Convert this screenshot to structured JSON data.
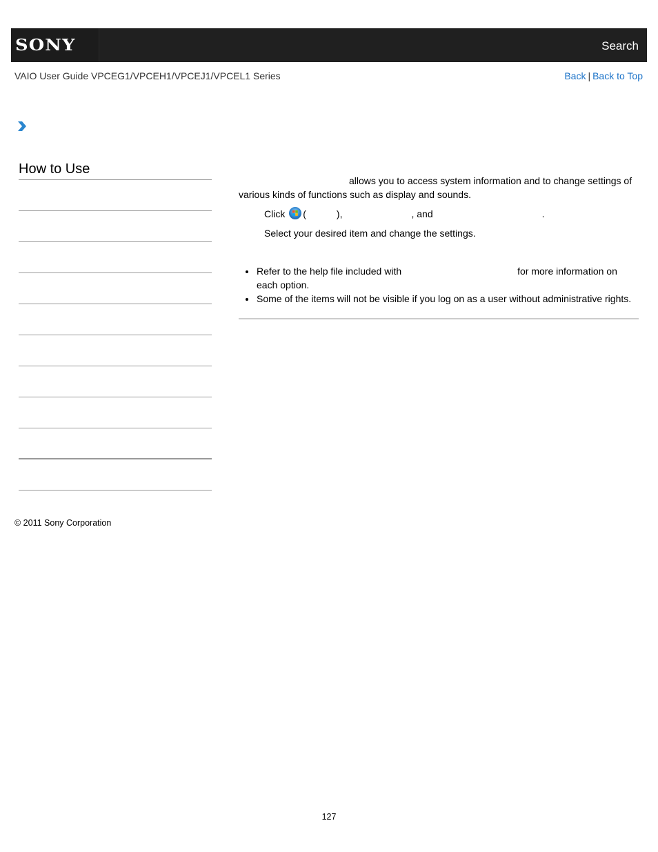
{
  "header": {
    "logo": "SONY",
    "search_label": "Search",
    "background_color": "#202020"
  },
  "subheader": {
    "guide_title": "VAIO User Guide VPCEG1/VPCEH1/VPCEJ1/VPCEL1 Series",
    "back_label": "Back",
    "separator": "|",
    "back_to_top_label": "Back to Top",
    "link_color": "#1a72c8"
  },
  "breadcrumb": {
    "icon": "chevron-right-icon"
  },
  "sidebar": {
    "title": "How to Use",
    "items": [
      {
        "label": ""
      },
      {
        "label": ""
      },
      {
        "label": ""
      },
      {
        "label": ""
      },
      {
        "label": ""
      },
      {
        "label": ""
      },
      {
        "label": ""
      },
      {
        "label": ""
      },
      {
        "label": ""
      },
      {
        "label": ""
      }
    ]
  },
  "content": {
    "intro": "allows you to access system information and to change settings of various kinds of functions such as display and sounds.",
    "step1": {
      "click": "Click",
      "icon": "windows-start-icon",
      "open_paren": "(",
      "close_paren_comma": "),",
      "and": ", and",
      "period": "."
    },
    "step2": "Select your desired item and change the settings.",
    "notes": [
      {
        "before": "Refer to the help file included with",
        "after": "for more information on each option."
      },
      {
        "text": "Some of the items will not be visible if you log on as a user without administrative rights."
      }
    ]
  },
  "footer": {
    "copyright": "© 2011 Sony Corporation",
    "page_number": "127"
  }
}
